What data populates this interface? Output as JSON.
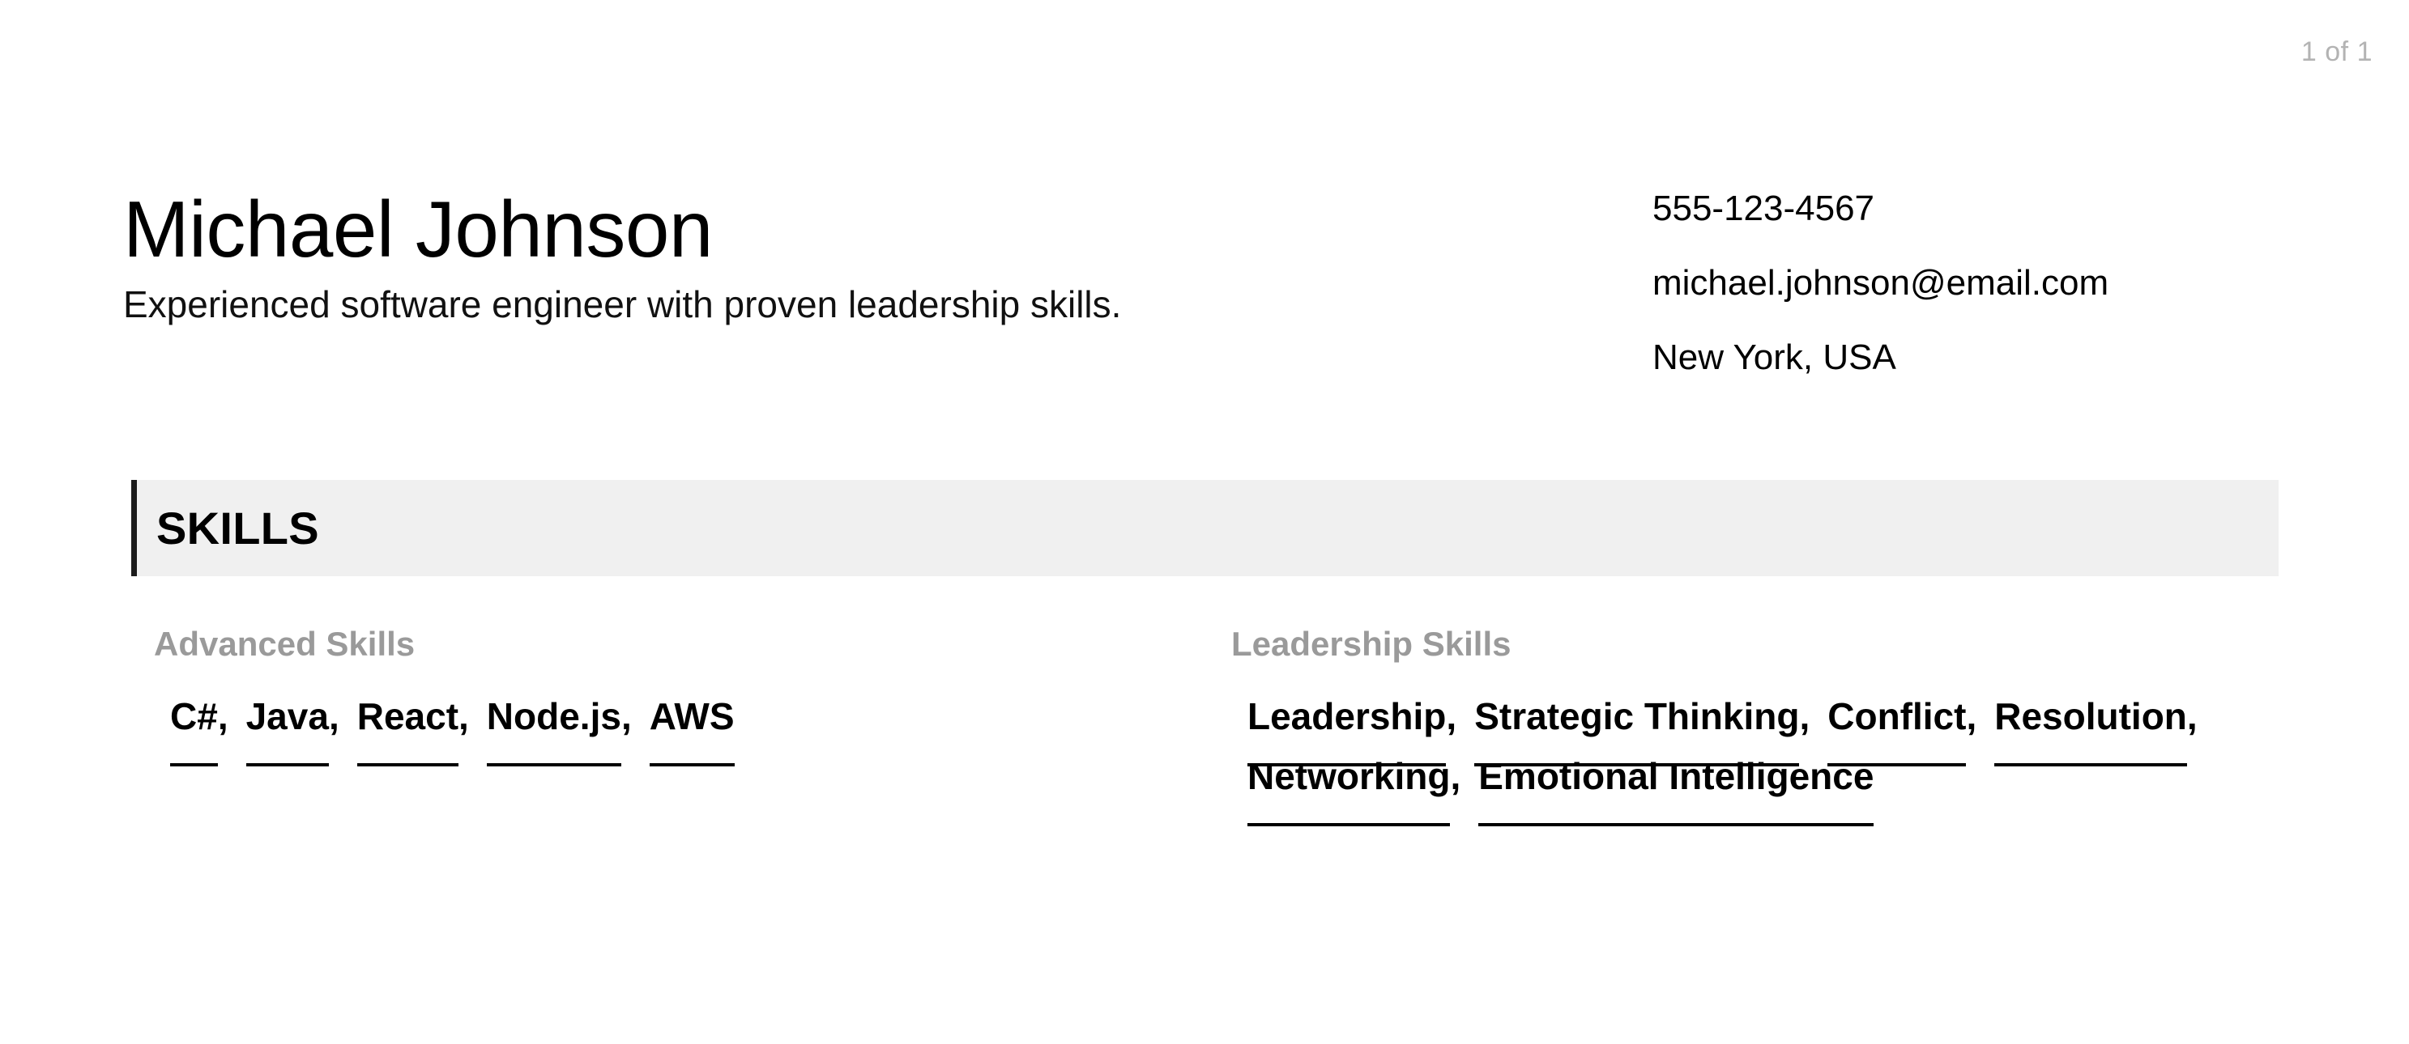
{
  "viewer": {
    "page_indicator": "1 of 1"
  },
  "resume": {
    "name": "Michael Johnson",
    "headline": "Experienced software engineer with proven leadership skills.",
    "contact": {
      "phone": "555-123-4567",
      "email": "michael.johnson@email.com",
      "location": "New York, USA"
    },
    "sections": [
      {
        "title": "SKILLS",
        "accent_color": "#1b1b1b",
        "background_color": "#f0f0f0",
        "groups": [
          {
            "label": "Advanced Skills",
            "items": [
              "C#",
              "Java",
              "React",
              "Node.js",
              "AWS"
            ]
          },
          {
            "label": "Leadership Skills",
            "items": [
              "Leadership",
              "Strategic Thinking",
              "Conflict",
              "Resolution",
              "Networking",
              "Emotional Intelligence"
            ]
          }
        ]
      }
    ]
  }
}
